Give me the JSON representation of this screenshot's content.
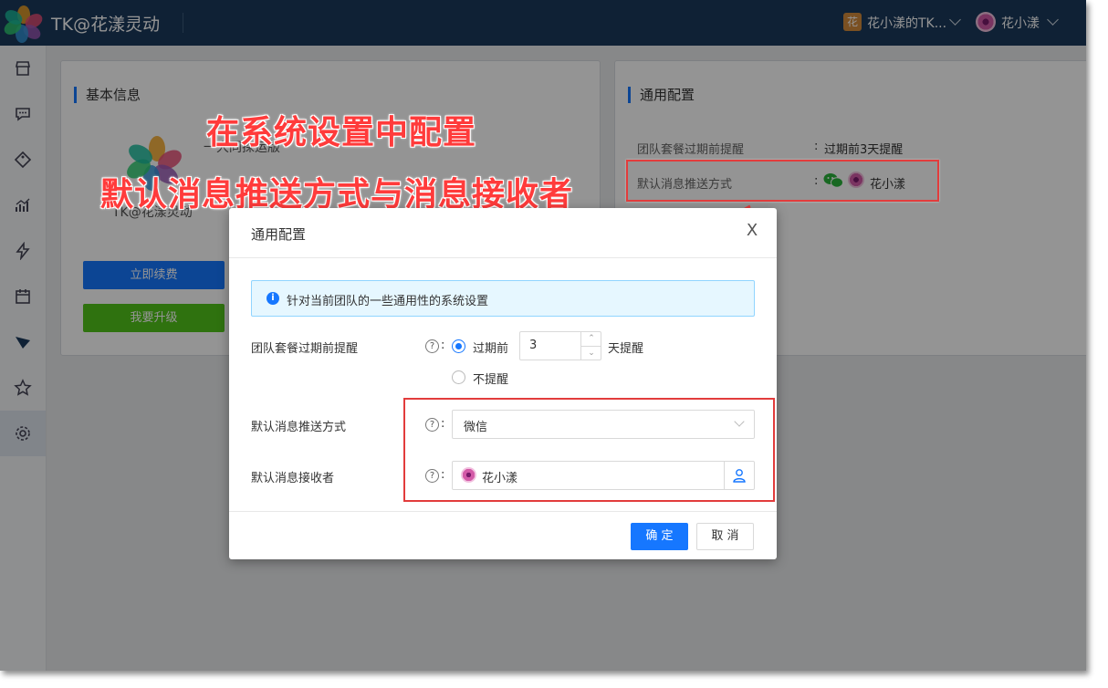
{
  "app": {
    "title": "TK@花漾灵动",
    "team_badge": "花",
    "team_name": "花小漾的TK...",
    "user_name": "花小漾"
  },
  "sidebar": {
    "items": [
      {
        "icon": "store-icon"
      },
      {
        "icon": "chat-icon"
      },
      {
        "icon": "tag-icon"
      },
      {
        "icon": "chart-icon"
      },
      {
        "icon": "lightning-icon"
      },
      {
        "icon": "calendar-icon"
      },
      {
        "icon": "send-icon"
      },
      {
        "icon": "star-icon"
      },
      {
        "icon": "settings-icon",
        "active": true
      }
    ]
  },
  "basic_panel": {
    "title": "基本信息",
    "brand": "TK@花漾灵动",
    "plan": "一大同探运版",
    "renew_button": "立即续费",
    "upgrade_button": "我要升级"
  },
  "general_panel": {
    "title": "通用配置",
    "rows": [
      {
        "label": "团队套餐过期前提醒",
        "value": "过期前3天提醒"
      },
      {
        "label": "默认消息推送方式",
        "value": "花小漾"
      }
    ],
    "colon": ":"
  },
  "annotation": {
    "line1": "在系统设置中配置",
    "line2": "默认消息推送方式与消息接收者"
  },
  "modal": {
    "title": "通用配置",
    "close": "X",
    "info": "针对当前团队的一些通用性的系统设置",
    "info_icon": "i",
    "help": "?",
    "colon": ":",
    "expiry": {
      "label": "团队套餐过期前提醒",
      "option_before": "过期前",
      "days": "3",
      "suffix": "天提醒",
      "option_none": "不提醒"
    },
    "push": {
      "label": "默认消息推送方式",
      "value": "微信"
    },
    "receiver": {
      "label": "默认消息接收者",
      "value": "花小漾"
    },
    "ok": "确 定",
    "cancel": "取 消"
  },
  "colors": {
    "topbar": "#1b3a5c",
    "primary": "#1677ff",
    "success": "#52c41a",
    "annotation": "#ff3b3b"
  }
}
